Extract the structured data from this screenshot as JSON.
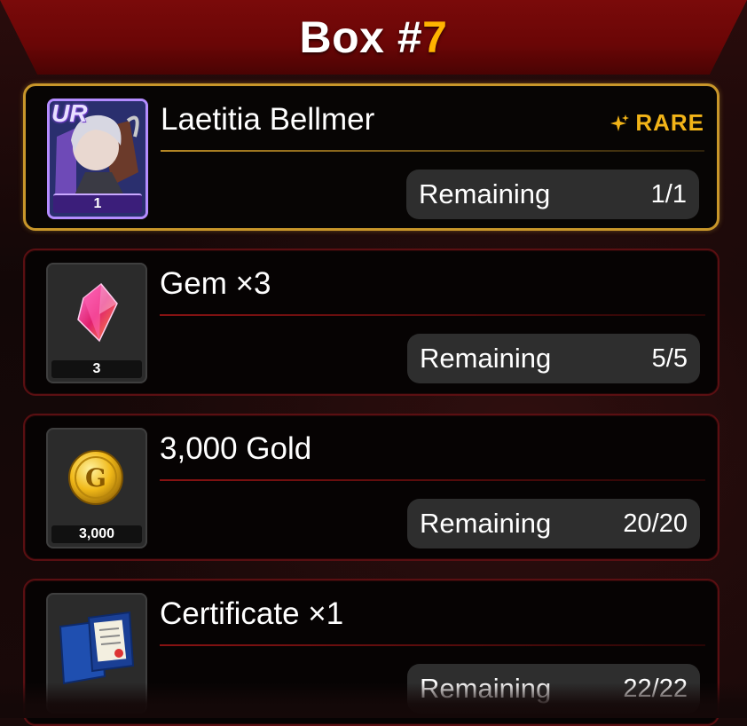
{
  "header": {
    "title_prefix": "Box #",
    "title_number": "7"
  },
  "rewards": [
    {
      "name": "Laetitia Bellmer",
      "thumb_count": "1",
      "rarity": "UR",
      "rare_label": "RARE",
      "remaining_label": "Remaining",
      "remaining_value": "1/1"
    },
    {
      "name": "Gem ×3",
      "thumb_count": "3",
      "remaining_label": "Remaining",
      "remaining_value": "5/5"
    },
    {
      "name": "3,000 Gold",
      "thumb_count": "3,000",
      "remaining_label": "Remaining",
      "remaining_value": "20/20"
    },
    {
      "name": "Certificate ×1",
      "thumb_count": "",
      "remaining_label": "Remaining",
      "remaining_value": "22/22"
    }
  ],
  "colors": {
    "header_red": "#6a0606",
    "title_number": "#ffb400",
    "rare_gold": "#f2b418",
    "ur_purple": "#b48cff"
  },
  "icons": {
    "card1": "character-portrait-icon",
    "card2": "gem-icon",
    "card3": "gold-coin-icon",
    "card4": "certificate-icon"
  }
}
